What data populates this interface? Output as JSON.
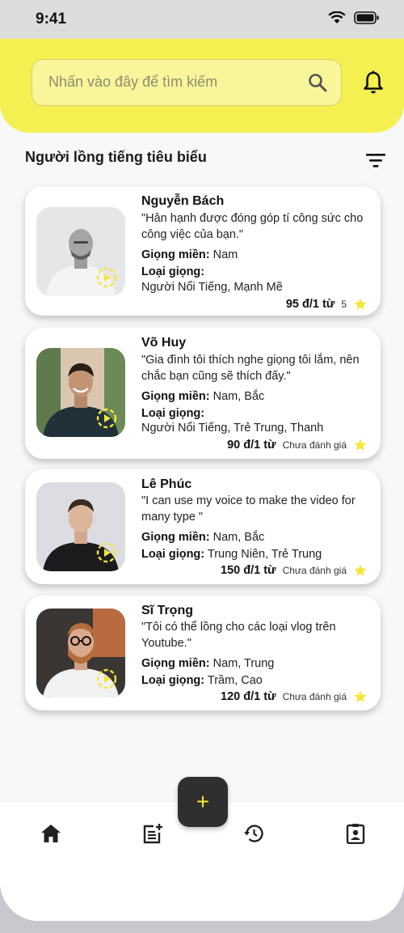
{
  "status_bar": {
    "time": "9:41"
  },
  "search": {
    "placeholder": "Nhấn vào đây để tìm kiếm"
  },
  "section": {
    "title": "Người lồng tiếng tiêu biểu"
  },
  "labels": {
    "region": "Giọng miền:",
    "voice_type": "Loại giọng:"
  },
  "voices": [
    {
      "name": "Nguyễn Bách",
      "quote": "\"Hân hạnh được đóng góp tí công sức cho công việc của bạn.\"",
      "region": "Nam",
      "voice_type": "Người Nổi Tiếng, Mạnh Mẽ",
      "price": "95 đ/1 từ",
      "rating": "5"
    },
    {
      "name": "Võ Huy",
      "quote": "\"Gia đình tôi thích nghe giọng tôi lắm, nên chắc bạn cũng sẽ thích đấy.\"",
      "region": "Nam, Bắc",
      "voice_type": "Người Nổi Tiếng, Trẻ Trung, Thanh",
      "price": "90 đ/1 từ",
      "rating": "Chưa đánh giá"
    },
    {
      "name": "Lê Phúc",
      "quote": "\"I can use my voice to make the video for many type \"",
      "region": "Nam, Bắc",
      "voice_type": "Trung Niên, Trẻ Trung",
      "price": "150 đ/1 từ",
      "rating": "Chưa đánh giá"
    },
    {
      "name": "Sĩ Trọng",
      "quote": "\"Tôi có thể lồng cho các loại vlog trên Youtube.\"",
      "region": "Nam, Trung",
      "voice_type": "Trầm, Cao",
      "price": "120 đ/1 từ",
      "rating": "Chưa đánh giá"
    }
  ],
  "fab": {
    "label": "+"
  },
  "nav": [
    "home-icon",
    "post-add-icon",
    "history-icon",
    "profile-badge-icon"
  ],
  "colors": {
    "accent": "#f5f051",
    "star": "#f5e639",
    "fab": "#2f2f2f"
  }
}
